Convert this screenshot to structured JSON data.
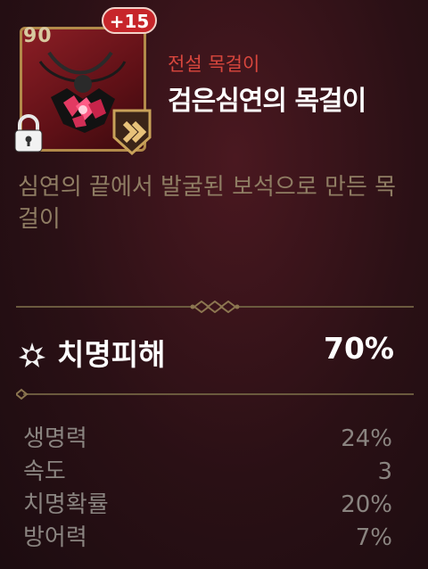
{
  "item": {
    "level": "90",
    "enhance": "+15",
    "grade": "전설 목걸이",
    "name": "검은심연의 목걸이",
    "description": "심연의 끝에서 발굴된 보석으로 만든 목걸이",
    "icons": [
      "necklace-icon",
      "lock-icon",
      "upgrade-arrow-icon",
      "crit-damage-icon"
    ]
  },
  "main_stat": {
    "label": "치명피해",
    "value": "70%"
  },
  "sub_stats": [
    {
      "label": "생명력",
      "value": "24%"
    },
    {
      "label": "속도",
      "value": "3"
    },
    {
      "label": "치명확률",
      "value": "20%"
    },
    {
      "label": "방어력",
      "value": "7%"
    }
  ],
  "colors": {
    "grade": "#d8463d",
    "frame_border": "#b28a4a",
    "enhance_badge": "#c7262b",
    "description": "#8f7d63",
    "sub_stat_text": "#8a8480"
  }
}
